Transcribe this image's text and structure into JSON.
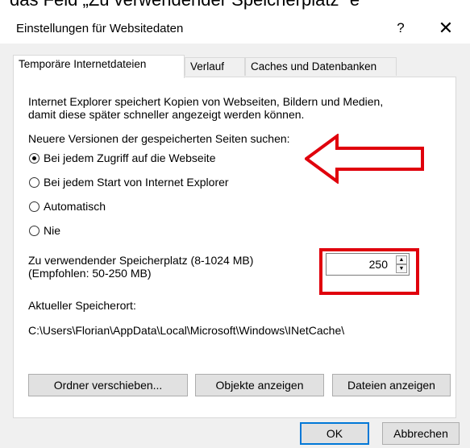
{
  "background_text": "das Feld „Zu verwendender Speicherplatz“ e",
  "dialog": {
    "title": "Einstellungen für Websitedaten",
    "help_label": "?",
    "close_label": "✕"
  },
  "tabs": [
    {
      "label": "Temporäre Internetdateien",
      "active": true
    },
    {
      "label": "Verlauf",
      "active": false
    },
    {
      "label": "Caches und Datenbanken",
      "active": false
    }
  ],
  "description": {
    "line1": "Internet Explorer speichert Kopien von Webseiten, Bildern und Medien,",
    "line2": "damit diese später schneller angezeigt werden können."
  },
  "check_versions": {
    "label": "Neuere Versionen der gespeicherten Seiten suchen:",
    "options": [
      {
        "label": "Bei jedem Zugriff auf die Webseite",
        "selected": true
      },
      {
        "label": "Bei jedem Start von Internet Explorer",
        "selected": false
      },
      {
        "label": "Automatisch",
        "selected": false
      },
      {
        "label": "Nie",
        "selected": false
      }
    ]
  },
  "disk_space": {
    "label_line1": "Zu verwendender Speicherplatz (8-1024 MB)",
    "label_line2": "(Empfohlen: 50-250 MB)",
    "value": "250"
  },
  "location": {
    "label": "Aktueller Speicherort:",
    "path": "C:\\Users\\Florian\\AppData\\Local\\Microsoft\\Windows\\INetCache\\"
  },
  "panel_buttons": {
    "move_folder": "Ordner verschieben...",
    "view_objects": "Objekte anzeigen",
    "view_files": "Dateien anzeigen"
  },
  "footer_buttons": {
    "ok": "OK",
    "cancel": "Abbrechen"
  },
  "colors": {
    "annotation_red": "#e0000c",
    "focus_blue": "#0078d7",
    "dialog_bg": "#f0f0f0"
  }
}
